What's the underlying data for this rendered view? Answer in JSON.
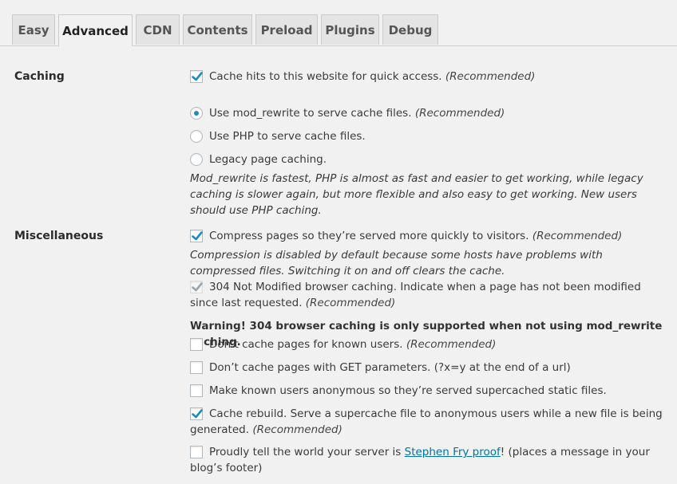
{
  "tabs": [
    "Easy",
    "Advanced",
    "CDN",
    "Contents",
    "Preload",
    "Plugins",
    "Debug"
  ],
  "active_tab": "Advanced",
  "caching": {
    "label": "Caching",
    "cache_hits": {
      "text": "Cache hits to this website for quick access.",
      "rec": "(Recommended)",
      "checked": true
    },
    "mod_rewrite": {
      "text": "Use mod_rewrite to serve cache files.",
      "rec": "(Recommended)",
      "selected": true
    },
    "use_php": {
      "text": "Use PHP to serve cache files.",
      "selected": false
    },
    "legacy": {
      "text": "Legacy page caching.",
      "selected": false
    },
    "note": "Mod_rewrite is fastest, PHP is almost as fast and easier to get working, while legacy caching is slower again, but more flexible and also easy to get working. New users should use PHP caching."
  },
  "misc": {
    "label": "Miscellaneous",
    "compress": {
      "text": "Compress pages so they’re served more quickly to visitors.",
      "rec": "(Recommended)",
      "checked": true
    },
    "compress_note": "Compression is disabled by default because some hosts have problems with compressed files. Switching it on and off clears the cache.",
    "not_modified": {
      "text": "304 Not Modified browser caching. Indicate when a page has not been modified since last requested.",
      "rec": "(Recommended)",
      "checked": true,
      "disabled": true
    },
    "warning": "Warning! 304 browser caching is only supported when not using mod_rewrite caching.",
    "known_users": {
      "text": "Don’t cache pages for known users.",
      "rec": "(Recommended)",
      "checked": false
    },
    "get_params": {
      "text": "Don’t cache pages with GET parameters. (?x=y at the end of a url)",
      "checked": false
    },
    "anonymous": {
      "text": "Make known users anonymous so they’re served supercached static files.",
      "checked": false
    },
    "rebuild": {
      "text": "Cache rebuild. Serve a supercache file to anonymous users while a new file is being generated.",
      "rec": "(Recommended)",
      "checked": true
    },
    "proof": {
      "text_before": "Proudly tell the world your server is ",
      "link": "Stephen Fry proof",
      "text_after": "! (places a message in your blog’s footer)",
      "checked": false
    }
  },
  "colors": {
    "accent": "#1e8cbe",
    "link": "#0074a2"
  }
}
